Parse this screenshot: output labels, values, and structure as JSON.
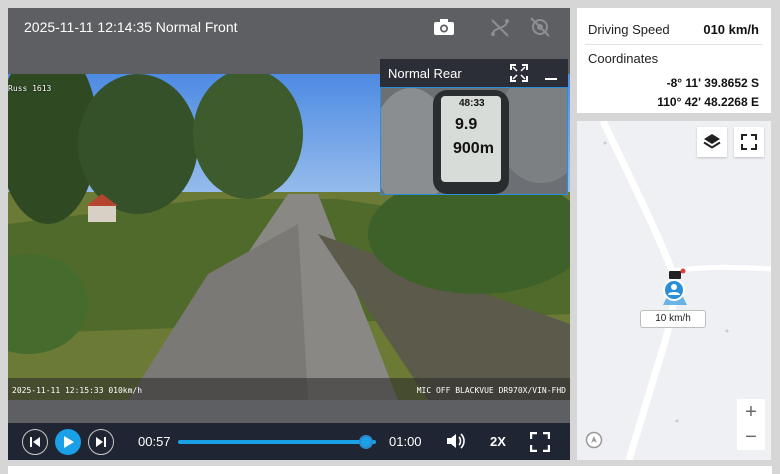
{
  "video": {
    "title": "2025-11-11 12:14:35 Normal Front",
    "osd_top": "Russ 1613",
    "osd_bottom_left": "2025-11-11 12:15:33 010km/h",
    "osd_bottom_right": "MIC OFF BLACKVUE DR970X/VIN-FHD"
  },
  "pip": {
    "title": "Normal Rear",
    "gauge_top": "48:33",
    "gauge_mid": "9.9",
    "gauge_bottom": "900m"
  },
  "controls": {
    "current_time": "00:57",
    "total_time": "01:00",
    "progress": 0.95,
    "playback_speed": "2X"
  },
  "info": {
    "speed_label": "Driving Speed",
    "speed_value": "010 km/h",
    "coordinates_label": "Coordinates",
    "latitude": "-8° 11' 39.8652 S",
    "longitude": "110° 42' 48.2268 E"
  },
  "map": {
    "speed_badge": "10 km/h",
    "zoom_in": "+",
    "zoom_out": "−"
  },
  "colors": {
    "accent": "#1aa0e6",
    "header_bg": "#5e5f63",
    "controls_bg": "#1f2532"
  }
}
